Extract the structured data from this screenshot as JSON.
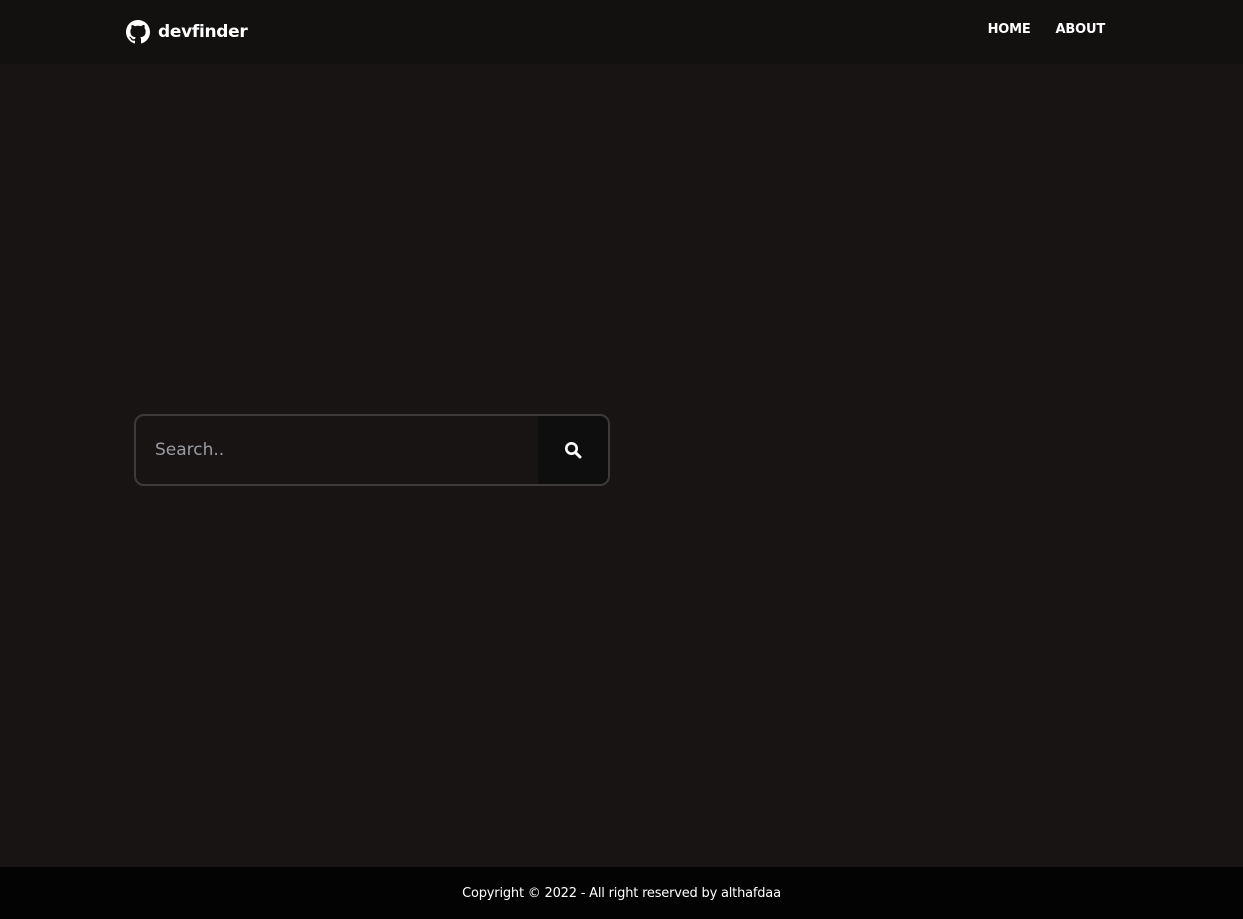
{
  "navbar": {
    "brand": {
      "icon": "github-icon",
      "name": "devfinder"
    },
    "links": [
      {
        "label": "HOME"
      },
      {
        "label": "ABOUT"
      }
    ]
  },
  "search": {
    "placeholder": "Search..",
    "value": "",
    "button_icon": "search-icon"
  },
  "footer": {
    "text": "Copyright © 2022 - All right reserved by althafdaa"
  },
  "colors": {
    "background": "#171413",
    "navbar": "#121110",
    "footer": "#030303",
    "search_border": "#3d3a39",
    "search_button": "#0f0e0e",
    "text": "#ffffff",
    "placeholder": "#9a9ba3"
  }
}
